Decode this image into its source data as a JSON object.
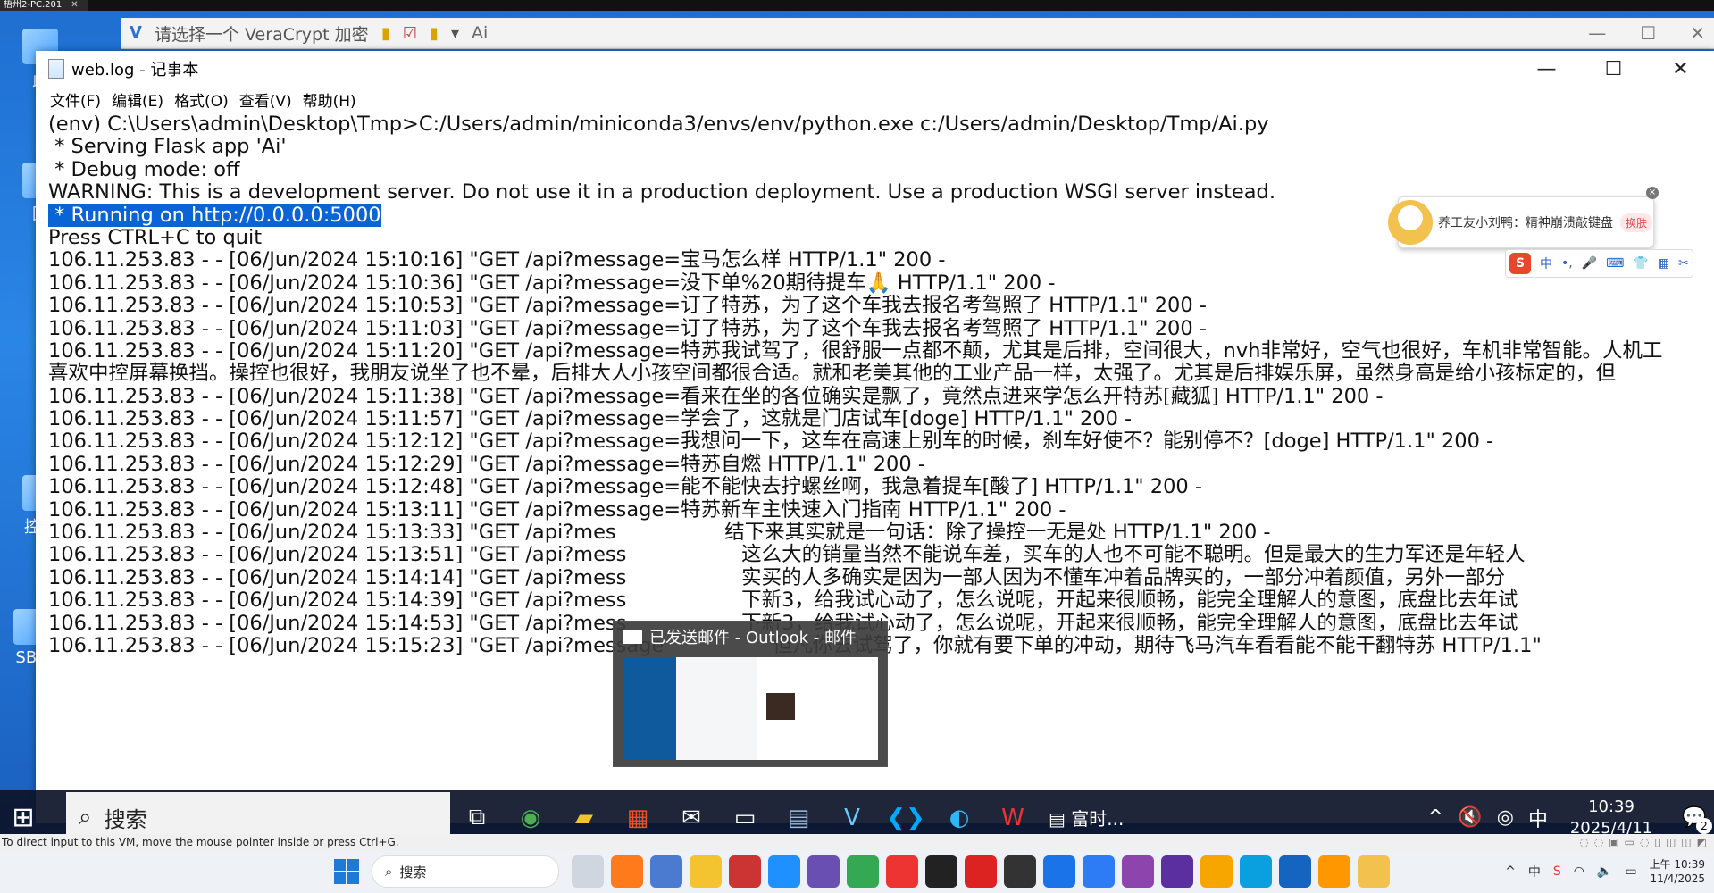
{
  "vm_window_tab": "梧州2-PC.201",
  "background_window": {
    "title": "请选择一个 VeraCrypt 加密",
    "ai_label": "Ai"
  },
  "desktop_icons": [
    "此",
    "回",
    "控制",
    "SBb"
  ],
  "notepad": {
    "title": "web.log - 记事本",
    "menu": [
      "文件(F)",
      "编辑(E)",
      "格式(O)",
      "查看(V)",
      "帮助(H)"
    ],
    "lines": [
      "(env) C:\\Users\\admin\\Desktop\\Tmp>C:/Users/admin/miniconda3/envs/env/python.exe c:/Users/admin/Desktop/Tmp/Ai.py",
      " * Serving Flask app 'Ai'",
      " * Debug mode: off",
      "WARNING: This is a development server. Do not use it in a production deployment. Use a production WSGI server instead.",
      " * Running on http://0.0.0.0:5000",
      "Press CTRL+C to quit",
      "106.11.253.83 - - [06/Jun/2024 15:10:16] \"GET /api?message=宝马怎么样 HTTP/1.1\" 200 -",
      "106.11.253.83 - - [06/Jun/2024 15:10:36] \"GET /api?message=没下单%20期待提车🙏 HTTP/1.1\" 200 -",
      "106.11.253.83 - - [06/Jun/2024 15:10:53] \"GET /api?message=订了特苏，为了这个车我去报名考驾照了 HTTP/1.1\" 200 -",
      "106.11.253.83 - - [06/Jun/2024 15:11:03] \"GET /api?message=订了特苏，为了这个车我去报名考驾照了 HTTP/1.1\" 200 -",
      "106.11.253.83 - - [06/Jun/2024 15:11:20] \"GET /api?message=特苏我试驾了，很舒服一点都不颠，尤其是后排，空间很大，nvh非常好，空气也很好，车机非常智能。人机工",
      "喜欢中控屏幕换挡。操控也很好，我朋友说坐了也不晕，后排大人小孩空间都很合适。就和老美其他的工业产品一样，太强了。尤其是后排娱乐屏，虽然身高是给小孩标定的，但",
      "106.11.253.83 - - [06/Jun/2024 15:11:38] \"GET /api?message=看来在坐的各位确实是飘了，竟然点进来学怎么开特苏[藏狐] HTTP/1.1\" 200 -",
      "106.11.253.83 - - [06/Jun/2024 15:11:57] \"GET /api?message=学会了，这就是门店试车[doge] HTTP/1.1\" 200 -",
      "106.11.253.83 - - [06/Jun/2024 15:12:12] \"GET /api?message=我想问一下，这车在高速上别车的时候，刹车好使不？能别停不？[doge] HTTP/1.1\" 200 -",
      "106.11.253.83 - - [06/Jun/2024 15:12:29] \"GET /api?message=特苏自燃 HTTP/1.1\" 200 -",
      "106.11.253.83 - - [06/Jun/2024 15:12:48] \"GET /api?message=能不能快去拧螺丝啊，我急着提车[酸了] HTTP/1.1\" 200 -",
      "106.11.253.83 - - [06/Jun/2024 15:13:11] \"GET /api?message=特苏新车主快速入门指南 HTTP/1.1\" 200 -",
      "106.11.253.83 - - [06/Jun/2024 15:13:33] \"GET /api?mes                 结下来其实就是一句话：除了操控一无是处 HTTP/1.1\" 200 -",
      "106.11.253.83 - - [06/Jun/2024 15:13:51] \"GET /api?mess                  这么大的销量当然不能说车差，买车的人也不可能不聪明。但是最大的生力军还是年轻人",
      "106.11.253.83 - - [06/Jun/2024 15:14:14] \"GET /api?mess                  实买的人多确实是因为一部人因为不懂车冲着品牌买的，一部分冲着颜值，另外一部分",
      "106.11.253.83 - - [06/Jun/2024 15:14:39] \"GET /api?mess                  下新3，给我试心动了，怎么说呢，开起来很顺畅，能完全理解人的意图，底盘比去年试",
      "106.11.253.83 - - [06/Jun/2024 15:14:53] \"GET /api?mess                  下新3，给我试心动了，怎么说呢，开起来很顺畅，能完全理解人的意图，底盘比去年试",
      "106.11.253.83 - - [06/Jun/2024 15:15:23] \"GET /api?message                 但凡你去试驾了，你就有要下单的冲动，期待飞马汽车看看能不能干翻特苏 HTTP/1.1\""
    ],
    "selected_line_index": 4
  },
  "ime_popup": {
    "message": "养工友小刘鸭：精神崩溃敲键盘",
    "button": "换肤",
    "toolbar": [
      "中",
      "•,",
      "🎤",
      "⌨",
      "👕",
      "▦",
      "✂"
    ]
  },
  "outlook_thumb": {
    "title": "已发送邮件 - Outlook - 邮件"
  },
  "vm_taskbar": {
    "search_placeholder": "搜索",
    "app_label": "富时...",
    "ime_lang": "中",
    "time": "10:39",
    "date": "2025/4/11",
    "notif_count": "2"
  },
  "vm_hint": "To direct input to this VM, move the mouse pointer inside or press Ctrl+G.",
  "host_taskbar": {
    "search_placeholder": "搜索",
    "ime": "中",
    "time": "上午 10:39",
    "date": "11/4/2025"
  },
  "colors": {
    "selection": "#0a64d6",
    "vm_taskbar": "#0c1428",
    "host_taskbar": "#eef1f6"
  }
}
